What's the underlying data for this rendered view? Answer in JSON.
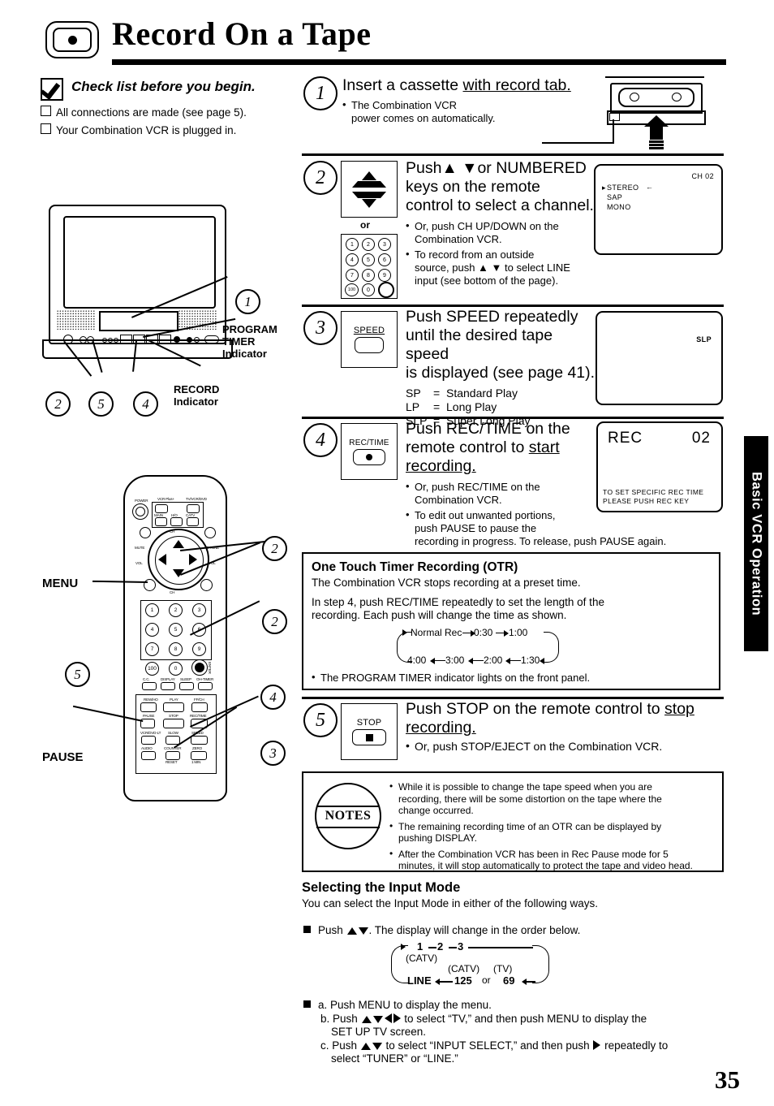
{
  "header": {
    "title": "Record On a Tape",
    "badge_icon": "record-dot-icon"
  },
  "checklist": {
    "title": "Check list before you begin.",
    "items": [
      "All connections are made (see page 5).",
      "Your Combination VCR is plugged in."
    ]
  },
  "tv_illustration": {
    "callouts": [
      {
        "marker": "1",
        "label": ""
      },
      {
        "marker": "2",
        "label": ""
      },
      {
        "marker": "5",
        "label": ""
      },
      {
        "marker": "4",
        "label": ""
      }
    ],
    "labels": {
      "program_timer": "PROGRAM\nTIMER\nIndicator",
      "program_timer_l1": "PROGRAM",
      "program_timer_l2": "TIMER",
      "program_timer_l3": "Indicator",
      "record_l1": "RECORD",
      "record_l2": "Indicator"
    }
  },
  "remote_illustration": {
    "labels": {
      "menu": "MENU",
      "pause": "PAUSE"
    },
    "callouts": [
      "2",
      "2",
      "5",
      "4",
      "3"
    ],
    "top_micro": [
      "POWER",
      "VCR Plus+",
      "TV/VCR/DVD",
      "MAIN",
      "H/O",
      "CATV"
    ],
    "dial_micro": [
      "CH",
      "MUTE",
      "R-TUNE",
      "VOL",
      "VOL",
      "SPEED",
      "SPEED",
      "CH"
    ],
    "keypad_keys": [
      "1",
      "2",
      "3",
      "4",
      "5",
      "6",
      "7",
      "8",
      "9",
      "100",
      "0"
    ],
    "enter_label": "ENTER",
    "row_micro": [
      "C.C.",
      "DISPLAY",
      "SLEEP",
      "OH-TIMER"
    ],
    "transport_micro": [
      "REW/HO",
      "PLAY",
      "FF/CH",
      "PAUSE",
      "STOP",
      "REC/TIME",
      "VCR/DVD-LT",
      "SLOW",
      "SPEED",
      "AUDIO",
      "COUNTER",
      "ZERO",
      "RESET",
      "1 MIN"
    ]
  },
  "steps": [
    {
      "num": "1",
      "heading_plain": "Insert a cassette ",
      "heading_underline": "with record tab.",
      "bullets": [
        "The Combination VCR\npower comes on automatically."
      ],
      "bullet_lines": [
        "The Combination VCR",
        "power comes on automatically."
      ],
      "illustration": "vhs-cassette-insert-icon"
    },
    {
      "num": "2",
      "key_icon": "channel-up-down-key-icon",
      "or_label": "or",
      "keypad_icon": "numbered-keys-icon",
      "heading_lines": [
        "Push▲ ▼or NUMBERED",
        "keys on the remote",
        "control to select a channel."
      ],
      "bullets": [
        [
          "Or, push CH UP/DOWN on the",
          "Combination VCR."
        ],
        [
          "To record from an outside",
          "source, push ▲ ▼ to select LINE",
          "input (see bottom of the page)."
        ]
      ],
      "screen": {
        "ch_label": "CH 02",
        "rows": [
          "STEREO",
          "SAP",
          "MONO"
        ],
        "cursor_left": "▸",
        "cursor_right": "←"
      }
    },
    {
      "num": "3",
      "key_label": "SPEED",
      "heading_lines": [
        "Push SPEED repeatedly",
        "until the desired tape speed",
        "is displayed (see page 41)."
      ],
      "legend": [
        {
          "abbr": "SP",
          "eq": "=",
          "name": "Standard Play"
        },
        {
          "abbr": "LP",
          "eq": "=",
          "name": "Long Play"
        },
        {
          "abbr": "SLP",
          "eq": "=",
          "name": "Super Long Play"
        }
      ],
      "screen": {
        "speed": "SLP"
      }
    },
    {
      "num": "4",
      "key_label": "REC/TIME",
      "heading_plain_1": "Push REC/TIME on the",
      "heading_plain_2": "remote control to ",
      "heading_underline_2": "start",
      "heading_underline_3": "recording.",
      "bullets": [
        [
          "Or, push REC/TIME on the",
          "Combination VCR."
        ],
        [
          "To edit out unwanted portions,",
          "push PAUSE to pause the",
          "recording in progress. To release, push PAUSE again."
        ]
      ],
      "screen": {
        "rec": "REC",
        "ch": "02",
        "hint_1": "TO SET SPECIFIC REC TIME",
        "hint_2": "PLEASE PUSH REC KEY"
      }
    },
    {
      "num": "5",
      "key_label": "STOP",
      "heading_plain": "Push STOP on the remote control to ",
      "heading_underline": "stop",
      "heading_underline_2": "recording.",
      "bullets": [
        [
          "Or, push STOP/EJECT on the Combination VCR."
        ]
      ]
    }
  ],
  "otr": {
    "title": "One Touch Timer Recording (OTR)",
    "p1": "The Combination VCR stops recording at a preset time.",
    "p2_l1": "In step 4, push REC/TIME repeatedly to set the length of the",
    "p2_l2": "recording. Each push will change the time as shown.",
    "cycle_top": [
      "Normal Rec",
      "0:30",
      "1:00"
    ],
    "cycle_bottom": [
      "4:00",
      "3:00",
      "2:00",
      "1:30"
    ],
    "footnote": "The PROGRAM TIMER indicator lights on the front panel."
  },
  "notes": {
    "seal_label": "NOTES",
    "items": [
      [
        "While it is possible to change the tape speed when you are",
        "recording, there will be some distortion on the tape where the",
        "change occurred."
      ],
      [
        "The remaining recording time of an OTR can be displayed by",
        "pushing DISPLAY."
      ],
      [
        "After the Combination VCR has been in Rec Pause mode for 5",
        "minutes, it will stop automatically to protect the tape and video head."
      ]
    ]
  },
  "input_mode": {
    "title": "Selecting the Input Mode",
    "intro": "You can select the Input Mode in either of the following ways.",
    "bullet1_pre": "Push ",
    "bullet1_post": ". The display will change in the order below.",
    "cycle": {
      "top": [
        "1",
        "2",
        "3"
      ],
      "top_sub": "(CATV)",
      "mid_sub_1": "(CATV)",
      "mid_sub_2": "(TV)",
      "bottom": [
        "LINE",
        "125",
        "or",
        "69"
      ]
    },
    "bullet2": [
      "a. Push MENU to display the menu.",
      "b. Push ▲ ▼ ◁ ▷ to select “TV,” and then push MENU to display the",
      "SET UP TV screen.",
      "c. Push ▲ ▼ to select “INPUT SELECT,” and then push ▷ repeatedly to",
      "select “TUNER” or “LINE.”"
    ],
    "b_line_a": "a. Push MENU to display the menu.",
    "b_line_b1_pre": "b. Push ",
    "b_line_b1_post": " to select “TV,” and then push MENU to display the",
    "b_line_b2": "SET UP TV screen.",
    "b_line_c1_pre": "c. Push ",
    "b_line_c1_mid": " to select “INPUT SELECT,” and then push ",
    "b_line_c1_post": " repeatedly to",
    "b_line_c2": "select “TUNER” or “LINE.”"
  },
  "side_tab": {
    "label": "Basic VCR Operation"
  },
  "page_number": "35"
}
